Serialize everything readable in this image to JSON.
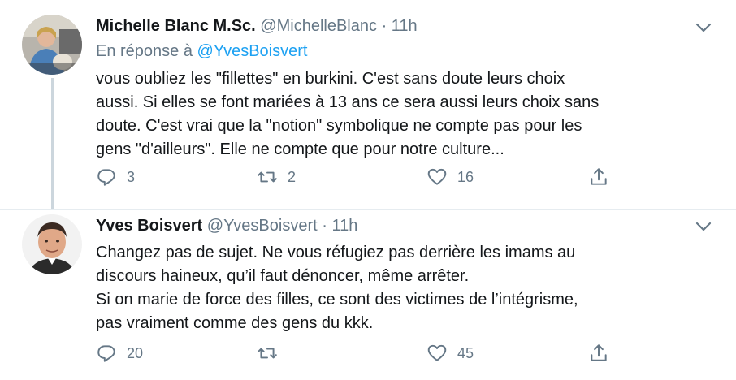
{
  "tweets": [
    {
      "name": "Michelle Blanc M.Sc.",
      "handle": "@MichelleBlanc",
      "dot": "·",
      "time": "11h",
      "reply_prefix": "En réponse à",
      "reply_to": "@YvesBoisvert",
      "lines": [
        "vous oubliez les \"fillettes\" en burkini. C'est sans doute leurs choix",
        "aussi. Si elles se font mariées à 13 ans ce sera aussi leurs choix sans",
        "doute. C'est vrai que la \"notion\" symbolique ne compte pas pour les",
        "gens \"d'ailleurs\". Elle ne compte que pour notre culture..."
      ],
      "reply_count": "3",
      "retweet_count": "2",
      "like_count": "16"
    },
    {
      "name": "Yves Boisvert",
      "handle": "@YvesBoisvert",
      "dot": "·",
      "time": "11h",
      "lines": [
        "Changez pas de sujet. Ne vous réfugiez pas derrière les imams au",
        "discours haineux, qu’il faut dénoncer, même arrêter.",
        "Si on marie de force des filles, ce sont des victimes de l’intégrisme,",
        "pas vraiment comme des gens du kkk."
      ],
      "reply_count": "20",
      "retweet_count": "",
      "like_count": "45"
    }
  ],
  "icons": {
    "reply": "reply-icon",
    "retweet": "retweet-icon",
    "like": "heart-icon",
    "share": "share-icon",
    "menu": "chevron-down-icon"
  },
  "colors": {
    "text": "#14171a",
    "secondary": "#657786",
    "link": "#1da1f2",
    "divider": "#e6ecf0"
  }
}
